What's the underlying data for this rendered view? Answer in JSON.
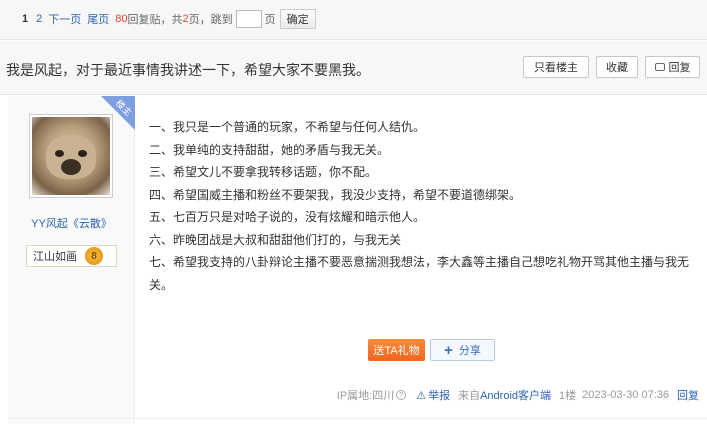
{
  "pager": {
    "pages": [
      "1",
      "2"
    ],
    "next": "下一页",
    "last": "尾页",
    "reply_count": "80",
    "reply_suffix": "回复贴，共",
    "total_pages": "2",
    "pages_suffix": "页，跳到",
    "jump_value": "",
    "page_unit": "页",
    "confirm": "确定"
  },
  "thread": {
    "title": "我是风起，对于最近事情我讲述一下，希望大家不要黑我。",
    "only_op": "只看楼主",
    "favorite": "收藏",
    "reply": "回复"
  },
  "post": {
    "op_badge": "楼主",
    "username": "YY风起《云散》",
    "badge_name": "江山如画",
    "level": "8",
    "lines": [
      "一、我只是一个普通的玩家，不希望与任何人结仇。",
      "二、我单纯的支持甜甜，她的矛盾与我无关。",
      "三、希望文儿不要拿我转移话题，你不配。",
      "四、希望国威主播和粉丝不要架我，我没少支持，希望不要道德绑架。",
      "五、七百万只是对哈子说的，没有炫耀和暗示他人。",
      "六、昨晚团战是大叔和甜甜他们打的，与我无关",
      "七、希望我支持的八卦辩论主播不要恶意揣测我想法，李大鑫等主播自己想吃礼物开骂其他主播与我无关。"
    ],
    "gift_label": "送TA礼物",
    "share_label": "分享",
    "ip": "IP属地:四川",
    "report": "举报",
    "from_prefix": "来自",
    "from_client": "Android客户端",
    "floor": "1楼",
    "time": "2023-03-30 07:36",
    "reply": "回复"
  },
  "colors": {
    "link": "#2d64b3",
    "accent_red": "#e2452b",
    "gift_orange": "#f0641e",
    "op_ribbon": "#7e9ee0"
  }
}
